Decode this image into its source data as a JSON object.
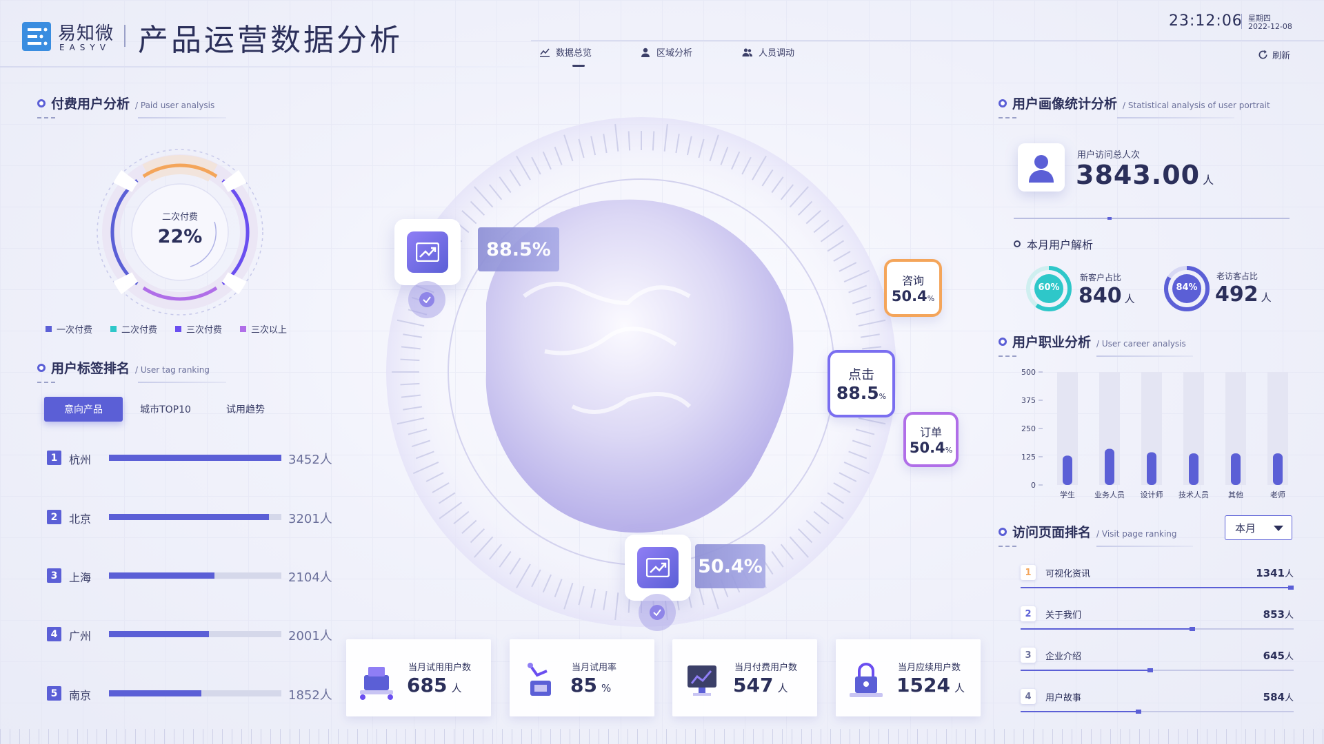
{
  "brand": {
    "cn": "易知微",
    "en": "EASYV"
  },
  "header": {
    "title": "产品运营数据分析",
    "time": "23:12:06",
    "weekday": "星期四",
    "date": "2022-12-08",
    "refresh": "刷新"
  },
  "nav": {
    "tabs": [
      {
        "label": "数据总览",
        "active": true
      },
      {
        "label": "区域分析",
        "active": false
      },
      {
        "label": "人员调动",
        "active": false
      }
    ]
  },
  "paid_users": {
    "title": "付费用户分析",
    "subtitle": "/ Paid user analysis",
    "center_label": "二次付费",
    "center_value": "22%",
    "legend": [
      {
        "label": "一次付费",
        "color": "#5b5fd6"
      },
      {
        "label": "二次付费",
        "color": "#2ec7c9"
      },
      {
        "label": "三次付费",
        "color": "#6a4ef0"
      },
      {
        "label": "三次以上",
        "color": "#b06ee8"
      }
    ]
  },
  "tag_ranking": {
    "title": "用户标签排名",
    "subtitle": "/ User tag ranking",
    "tabs": [
      {
        "label": "意向产品",
        "active": true
      },
      {
        "label": "城市TOP10",
        "active": false
      },
      {
        "label": "试用趋势",
        "active": false
      }
    ],
    "rows": [
      {
        "rank": "1",
        "city": "杭州",
        "value": 3452,
        "display": "3452人"
      },
      {
        "rank": "2",
        "city": "北京",
        "value": 3201,
        "display": "3201人"
      },
      {
        "rank": "3",
        "city": "上海",
        "value": 2104,
        "display": "2104人"
      },
      {
        "rank": "4",
        "city": "广州",
        "value": 2001,
        "display": "2001人"
      },
      {
        "rank": "5",
        "city": "南京",
        "value": 1852,
        "display": "1852人"
      }
    ],
    "max": 3452
  },
  "globe": {
    "badge_top_pct": "88.5%",
    "badge_bottom_pct": "50.4%",
    "metrics": [
      {
        "label": "咨询",
        "value": "50.4",
        "unit": "%",
        "color": "#f4a55a"
      },
      {
        "label": "点击",
        "value": "88.5",
        "unit": "%",
        "color": "#7a6ef0"
      },
      {
        "label": "订单",
        "value": "50.4",
        "unit": "%",
        "color": "#b06ee8"
      }
    ]
  },
  "stats": [
    {
      "label": "当月试用用户数",
      "value": "685",
      "unit": "人"
    },
    {
      "label": "当月试用率",
      "value": "85",
      "unit": "%"
    },
    {
      "label": "当月付费用户数",
      "value": "547",
      "unit": "人"
    },
    {
      "label": "当月应续用户数",
      "value": "1524",
      "unit": "人"
    }
  ],
  "portrait": {
    "title": "用户画像统计分析",
    "subtitle": "/ Statistical analysis of user portrait",
    "visit_label": "用户访问总人次",
    "visit_value": "3843.00",
    "visit_unit": "人",
    "month_title": "本月用户解析",
    "new_ratio": {
      "label": "新客户占比",
      "pct": "60%",
      "pct_value": 60,
      "value": "840",
      "unit": "人",
      "color": "#2ec7c9"
    },
    "old_ratio": {
      "label": "老访客占比",
      "pct": "84%",
      "pct_value": 84,
      "value": "492",
      "unit": "人",
      "color": "#5b5fd6"
    }
  },
  "career": {
    "title": "用户职业分析",
    "subtitle": "/ User career analysis",
    "chart_data": {
      "type": "bar",
      "categories": [
        "学生",
        "业务人员",
        "设计师",
        "技术人员",
        "其他",
        "老师"
      ],
      "values": [
        130,
        160,
        145,
        140,
        140,
        140
      ],
      "ylim": [
        0,
        500
      ],
      "yticks": [
        0,
        125,
        250,
        375,
        500
      ]
    }
  },
  "visit_pages": {
    "title": "访问页面排名",
    "subtitle": "/ Visit page ranking",
    "period": "本月",
    "rows": [
      {
        "rank": "1",
        "name": "可视化资讯",
        "value": 1341,
        "display": "1341",
        "unit": "人"
      },
      {
        "rank": "2",
        "name": "关于我们",
        "value": 853,
        "display": "853",
        "unit": "人"
      },
      {
        "rank": "3",
        "name": "企业介绍",
        "value": 645,
        "display": "645",
        "unit": "人"
      },
      {
        "rank": "4",
        "name": "用户故事",
        "value": 584,
        "display": "584",
        "unit": "人"
      }
    ],
    "max": 1341
  }
}
